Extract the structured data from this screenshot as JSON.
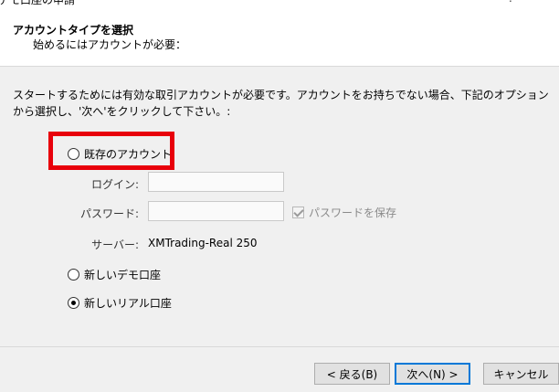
{
  "window": {
    "title_fragment": "デモ口座の申請",
    "corner_fragment": "?"
  },
  "header": {
    "heading": "アカウントタイプを選択",
    "subheading": "始めるにはアカウントが必要："
  },
  "instruction": "スタートするためには有効な取引アカウントが必要です。アカウントをお持ちでない場合、下記のオプションから選択し、'次へ'をクリックして下さい。:",
  "options": {
    "existing_account": {
      "label": "既存のアカウント",
      "selected": false
    },
    "new_demo": {
      "label": "新しいデモ口座",
      "selected": false
    },
    "new_real": {
      "label": "新しいリアル口座",
      "selected": true
    }
  },
  "login_form": {
    "login_label": "ログイン:",
    "login_value": "",
    "password_label": "パスワード:",
    "password_value": "",
    "save_password_label": "パスワードを保存",
    "save_password_checked": true,
    "server_label": "サーバー:",
    "server_value": "XMTrading-Real 250"
  },
  "buttons": {
    "back": "< 戻る(B)",
    "next": "次へ(N) >",
    "cancel": "キャンセル"
  },
  "colors": {
    "highlight": "#e8000b",
    "primary_border": "#0078d7"
  }
}
